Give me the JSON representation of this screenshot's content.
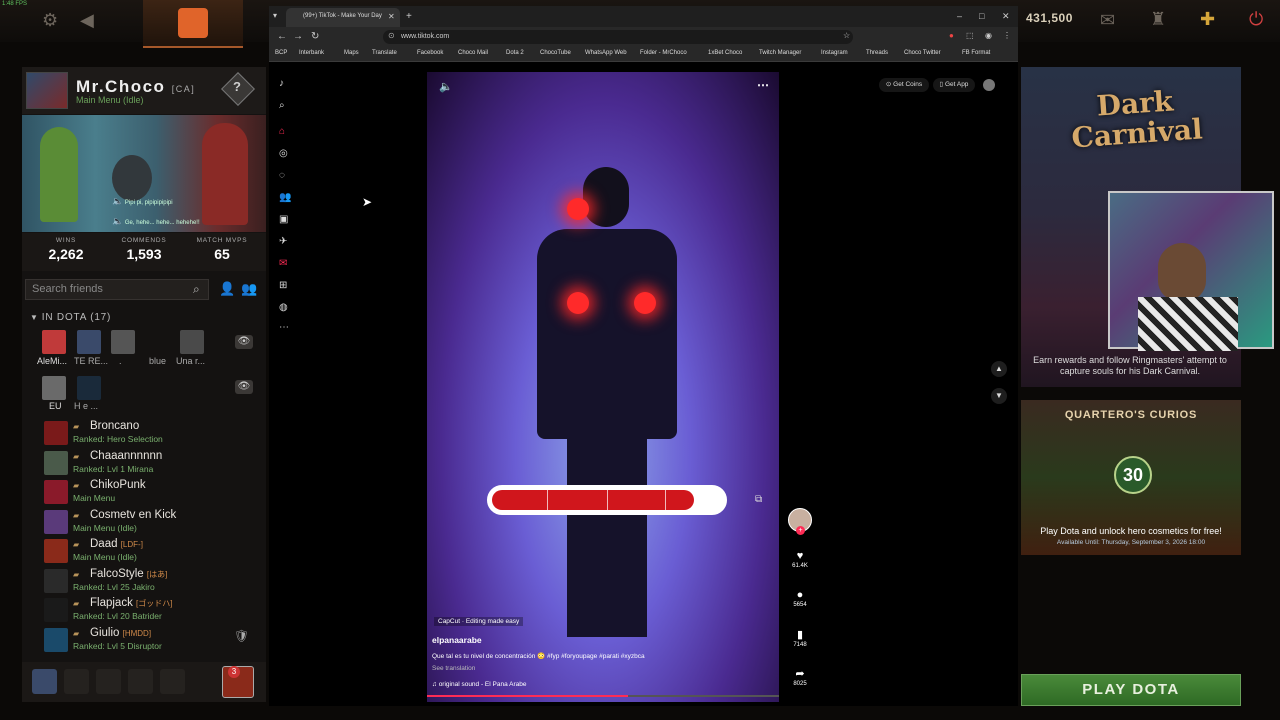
{
  "dota": {
    "fps_label": "1:48 FPS",
    "gold": "431,500",
    "profile": {
      "name": "Mr.Choco",
      "tag": "[CA]",
      "status": "Main Menu (Idle)",
      "rank_symbol": "?"
    },
    "showcase_chat": {
      "line1": "Pipi pi, pipipipipipi",
      "line2": "Ge, hehe... hehe... hehehe!!"
    },
    "stats": [
      {
        "label": "WINS",
        "value": "2,262"
      },
      {
        "label": "COMMENDS",
        "value": "1,593"
      },
      {
        "label": "MATCH MVPS",
        "value": "65"
      }
    ],
    "search_friends_placeholder": "Search friends",
    "in_dota_header": "IN DOTA (17)",
    "in_dota_tiles": [
      {
        "label": "AleMi..."
      },
      {
        "label": "TE RE..."
      },
      {
        "label": "."
      },
      {
        "label": "blue"
      },
      {
        "label": "Una r..."
      }
    ],
    "in_dota_row2": [
      {
        "label": "EU"
      },
      {
        "label": "H e ..."
      }
    ],
    "friends": [
      {
        "name": "Broncano",
        "tag": "",
        "status": "Ranked: Hero Selection",
        "color": "#7a1a1a"
      },
      {
        "name": "Chaaannnnnn",
        "tag": "",
        "status": "Ranked: Lvl 1 Mirana",
        "color": "#4a5a4a"
      },
      {
        "name": "ChikoPunk",
        "tag": "",
        "status": "Main Menu",
        "color": "#8a1a2a"
      },
      {
        "name": "Cosmetv en Kick",
        "tag": "",
        "status": "Main Menu (Idle)",
        "color": "#5a3a7a"
      },
      {
        "name": "Daad",
        "tag": "[LDF-]",
        "status": "Main Menu (Idle)",
        "color": "#8a2a1a"
      },
      {
        "name": "FalcoStyle",
        "tag": "[はあ]",
        "status": "Ranked: Lvl 25 Jakiro",
        "color": "#2a2a2a"
      },
      {
        "name": "Flapjack",
        "tag": "[ゴッドハ]",
        "status": "Ranked: Lvl 20 Batrider",
        "color": "#1a1a1a"
      },
      {
        "name": "Giulio",
        "tag": "[HMDD]",
        "status": "Ranked: Lvl 5 Disruptor",
        "color": "#1a4a6a"
      }
    ],
    "dock_notification_count": "3",
    "dark_carnival": {
      "title": "Dark Carnival",
      "text": "Earn rewards and follow Ringmasters' attempt to capture souls for his Dark Carnival."
    },
    "curios": {
      "title": "QUARTERO'S CURIOS",
      "badge": "30",
      "text": "Play Dota and unlock hero cosmetics for free!",
      "available": "Available Until:  Thursday, September 3, 2026 18:00"
    },
    "play_button": "PLAY DOTA"
  },
  "browser": {
    "tab_title": "(99+) TikTok - Make Your Day",
    "url": "www.tiktok.com",
    "bookmarks": [
      "BCP",
      "Interbank",
      "Maps",
      "Translate",
      "Facebook",
      "Choco Mail",
      "Dota 2",
      "ChocoTube",
      "WhatsApp Web",
      "Folder - MrChoco",
      "1xBet Choco",
      "Twitch Manager",
      "Instagram",
      "Threads",
      "Choco Twitter",
      "FB Format"
    ]
  },
  "tiktok": {
    "get_coins": "Get Coins",
    "get_app": "Get App",
    "capcut_label": "CapCut · Editing made easy",
    "author": "elpanaarabe",
    "caption": "Que tal es tu nivel de concentración 😳 #fyp #foryoupage #parati #xyzbca",
    "see_translation": "See translation",
    "sound": "original sound - El Pana Arabe",
    "likes": "61.4K",
    "comments": "5654",
    "saves": "7148",
    "shares": "8025",
    "video_progress": 0.57,
    "bar_fill": 0.88
  }
}
